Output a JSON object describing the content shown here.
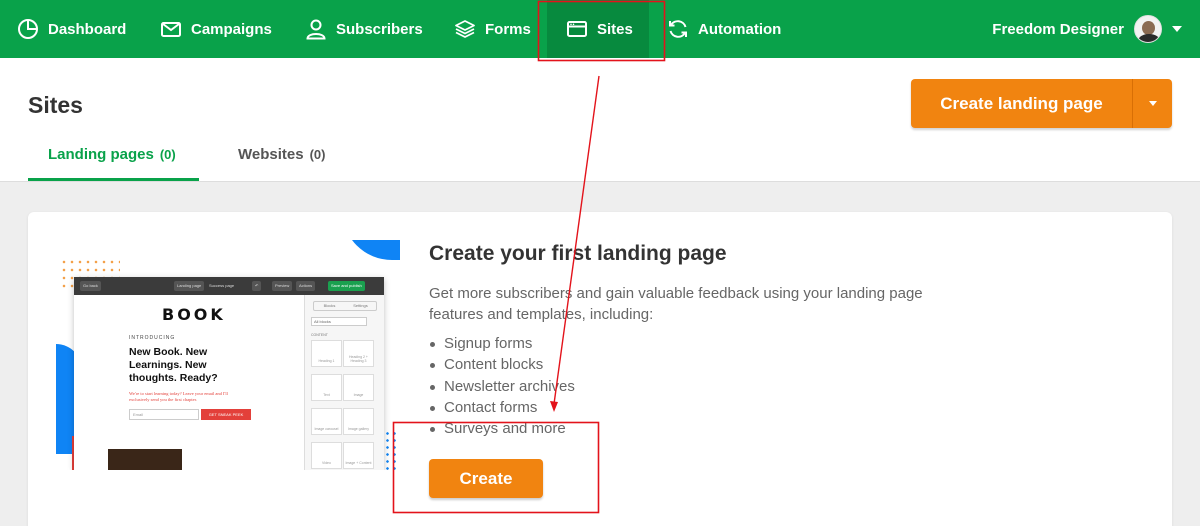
{
  "nav": {
    "items": [
      {
        "label": "Dashboard",
        "icon": "dashboard-icon"
      },
      {
        "label": "Campaigns",
        "icon": "envelope-icon"
      },
      {
        "label": "Subscribers",
        "icon": "user-icon"
      },
      {
        "label": "Forms",
        "icon": "layers-icon"
      },
      {
        "label": "Sites",
        "icon": "browser-window-icon"
      },
      {
        "label": "Automation",
        "icon": "refresh-icon"
      }
    ],
    "active": "Sites",
    "user_name": "Freedom Designer"
  },
  "header": {
    "title": "Sites",
    "create_button": "Create landing page",
    "tabs": [
      {
        "label": "Landing pages",
        "count": "(0)"
      },
      {
        "label": "Websites",
        "count": "(0)"
      }
    ]
  },
  "empty_state": {
    "title": "Create your first landing page",
    "description": "Get more subscribers and gain valuable feedback using your landing page features and templates, including:",
    "features": [
      "Signup forms",
      "Content blocks",
      "Newsletter archives",
      "Contact forms",
      "Surveys and more"
    ],
    "create_button": "Create"
  },
  "illustration": {
    "toolbar": {
      "back": "Go back",
      "tab1": "Landing page",
      "tab2": "Success page",
      "preview": "Preview",
      "actions": "Actions",
      "publish": "Save and publish"
    },
    "logo": "BOOK",
    "intro": "INTRODUCING",
    "headline": "New Book. New Learnings. New thoughts. Ready?",
    "subtext": "We're to start learning today? Leave your email and I'll exclusively send you the first chapter.",
    "email_placeholder": "Email",
    "cta": "GET SNEAK PEEK",
    "side_tabs": [
      "Blocks",
      "Settings"
    ],
    "side_select": "All blocks",
    "side_label": "CONTENT",
    "side_cells": [
      "Heading 1",
      "Heading 2 + Heading 3",
      "Text",
      "Image",
      "Image carousel",
      "Image gallery",
      "Video",
      "Image + Content"
    ]
  },
  "colors": {
    "brand_green": "#09a24a",
    "accent_orange": "#f18410",
    "annotation_red": "#e3131b"
  }
}
